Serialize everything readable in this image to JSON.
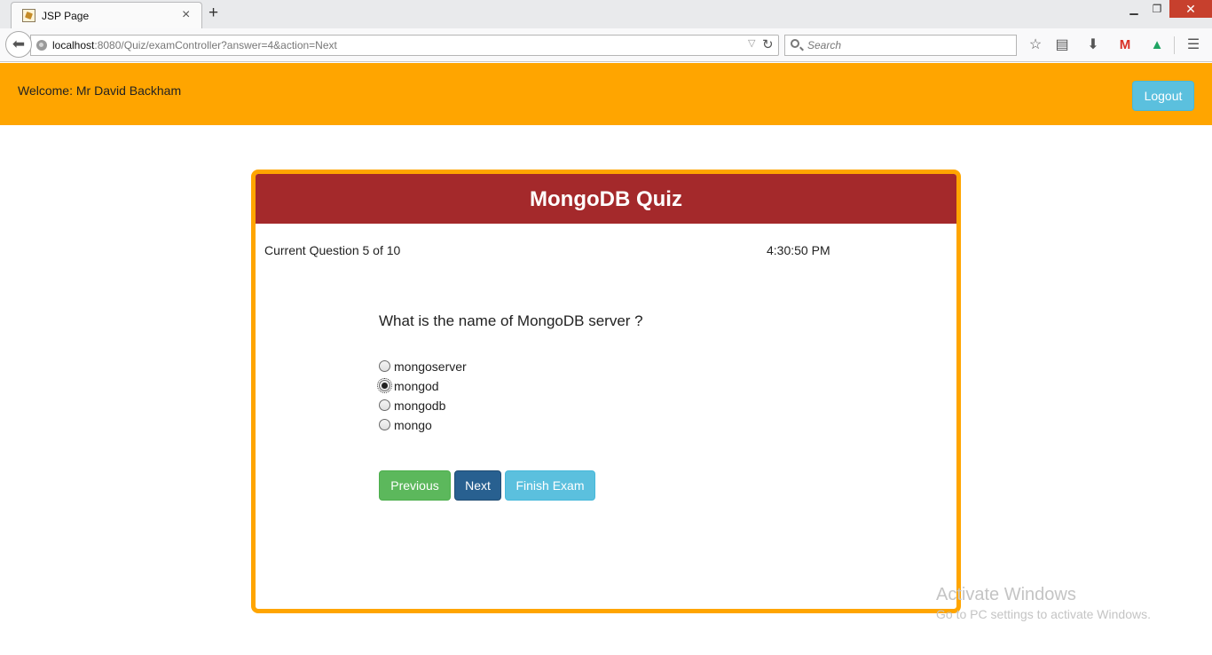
{
  "browser": {
    "tab_title": "JSP Page",
    "tab_close": "×",
    "new_tab": "+",
    "url_host": "localhost",
    "url_rest": ":8080/Quiz/examController?answer=4&action=Next",
    "search_placeholder": "Search",
    "window_controls": {
      "minimize": "▁",
      "maximize": "❐",
      "close": "✕"
    },
    "toolbar_icons": [
      "star-icon",
      "reading-list-icon",
      "download-icon",
      "gmail-icon",
      "google-drive-icon",
      "menu-icon"
    ]
  },
  "header": {
    "welcome": "Welcome: Mr David Backham",
    "logout_label": "Logout",
    "bg_color": "#ffa500"
  },
  "quiz": {
    "title": "MongoDB Quiz",
    "counter": "Current Question 5 of 10",
    "time": "4:30:50 PM",
    "question": "What is the name of MongoDB server ?",
    "options": [
      {
        "label": "mongoserver",
        "checked": false
      },
      {
        "label": "mongod",
        "checked": true
      },
      {
        "label": "mongodb",
        "checked": false
      },
      {
        "label": "mongo",
        "checked": false
      }
    ],
    "buttons": {
      "previous": "Previous",
      "next": "Next",
      "finish": "Finish Exam"
    },
    "title_bg_color": "#a4292b",
    "border_color": "#ffa500"
  },
  "watermark": {
    "title": "Activate Windows",
    "subtitle": "Go to PC settings to activate Windows."
  }
}
